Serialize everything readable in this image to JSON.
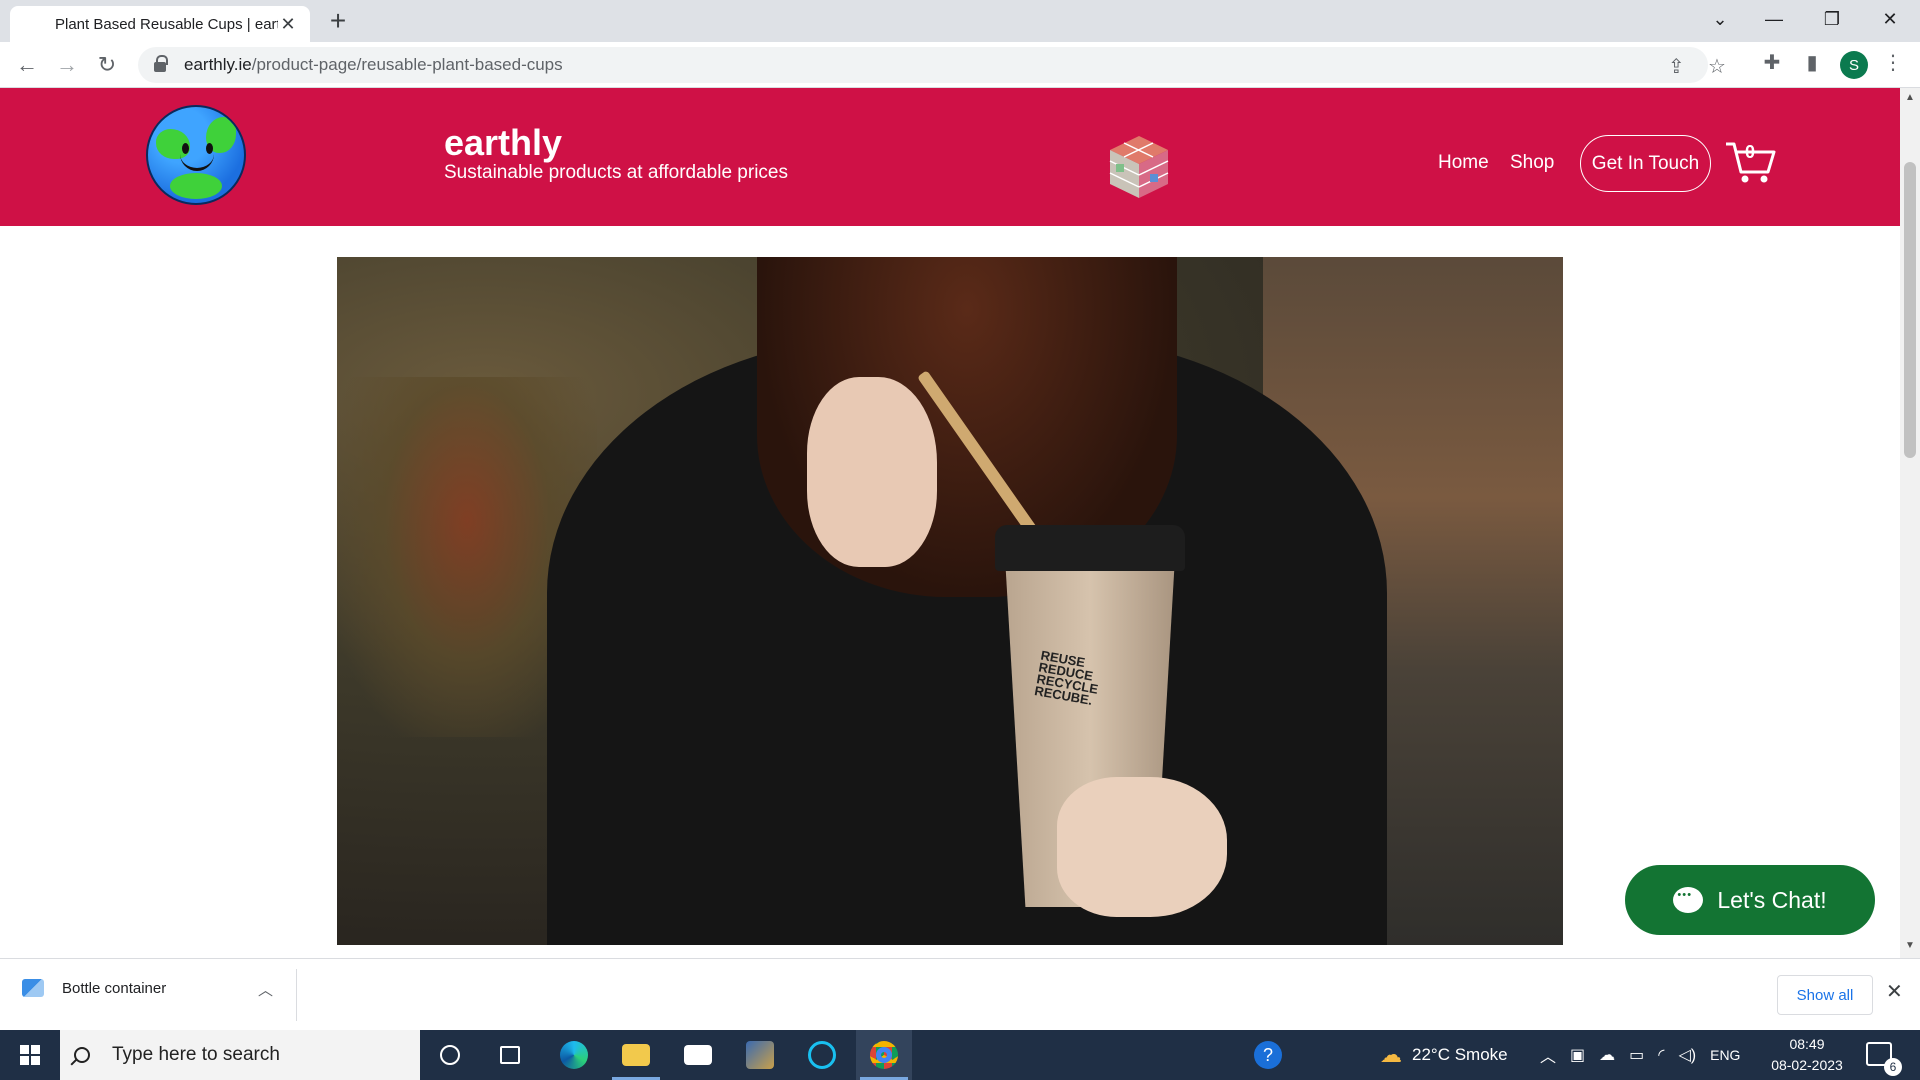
{
  "browser": {
    "tab_title": "Plant Based Reusable Cups | earthly",
    "url_host": "earthly.ie",
    "url_path": "/product-page/reusable-plant-based-cups",
    "profile_initial": "S"
  },
  "site": {
    "brand": "earthly",
    "tagline": "Sustainable products at affordable prices",
    "nav": {
      "home": "Home",
      "shop": "Shop",
      "contact": "Get In Touch"
    },
    "cart_count": "0",
    "hero_cup_text": "REUSE REDUCE RECYCLE RECUBE.",
    "chat_label": "Let's Chat!"
  },
  "downloads": {
    "item_name": "Bottle container",
    "show_all": "Show all"
  },
  "taskbar": {
    "search_placeholder": "Type here to search",
    "weather": "22°C  Smoke",
    "language": "ENG",
    "time": "08:49",
    "date": "08-02-2023",
    "notification_count": "6"
  },
  "colors": {
    "header_bg": "#cf1146",
    "chat_bg": "#137433",
    "taskbar_bg": "#1f2f45"
  }
}
